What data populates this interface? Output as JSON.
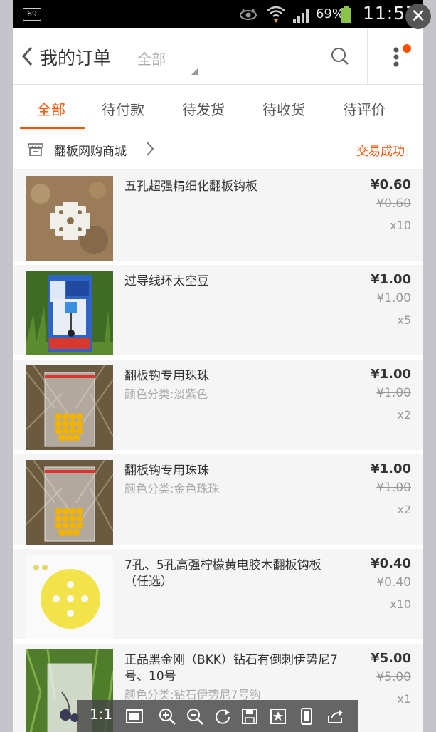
{
  "status_bar": {
    "badge": "69",
    "battery_pct": "69%",
    "time": "11:57"
  },
  "header": {
    "title": "我的订单",
    "filter": "全部"
  },
  "tabs": [
    {
      "label": "全部",
      "active": true
    },
    {
      "label": "待付款"
    },
    {
      "label": "待发货"
    },
    {
      "label": "待收货"
    },
    {
      "label": "待评价"
    }
  ],
  "shop": {
    "name": "翻板网购商城",
    "status": "交易成功"
  },
  "items": [
    {
      "title": "五孔超强精细化翻板钩板",
      "spec": "",
      "price": "¥0.60",
      "orig_price": "¥0.60",
      "qty": "x10"
    },
    {
      "title": "过导线环太空豆",
      "spec": "",
      "price": "¥1.00",
      "orig_price": "¥1.00",
      "qty": "x5"
    },
    {
      "title": "翻板钩专用珠珠",
      "spec": "颜色分类:淡紫色",
      "price": "¥1.00",
      "orig_price": "¥1.00",
      "qty": "x2"
    },
    {
      "title": "翻板钩专用珠珠",
      "spec": "颜色分类:金色珠珠",
      "price": "¥1.00",
      "orig_price": "¥1.00",
      "qty": "x2"
    },
    {
      "title": "7孔、5孔高强柠檬黄电胶木翻板钩板（任选）",
      "spec": "",
      "price": "¥0.40",
      "orig_price": "¥0.40",
      "qty": "x10"
    },
    {
      "title": "正品黑金刚（BKK）钻石有倒刺伊势尼7号、10号",
      "spec": "颜色分类:钻石伊势尼7号钩",
      "price": "¥5.00",
      "orig_price": "¥5.00",
      "qty": "x1"
    }
  ],
  "viewer_toolbar": {
    "zoom_label": "1:1"
  },
  "colors": {
    "accent": "#ff5000",
    "status_bar": "#000000"
  }
}
